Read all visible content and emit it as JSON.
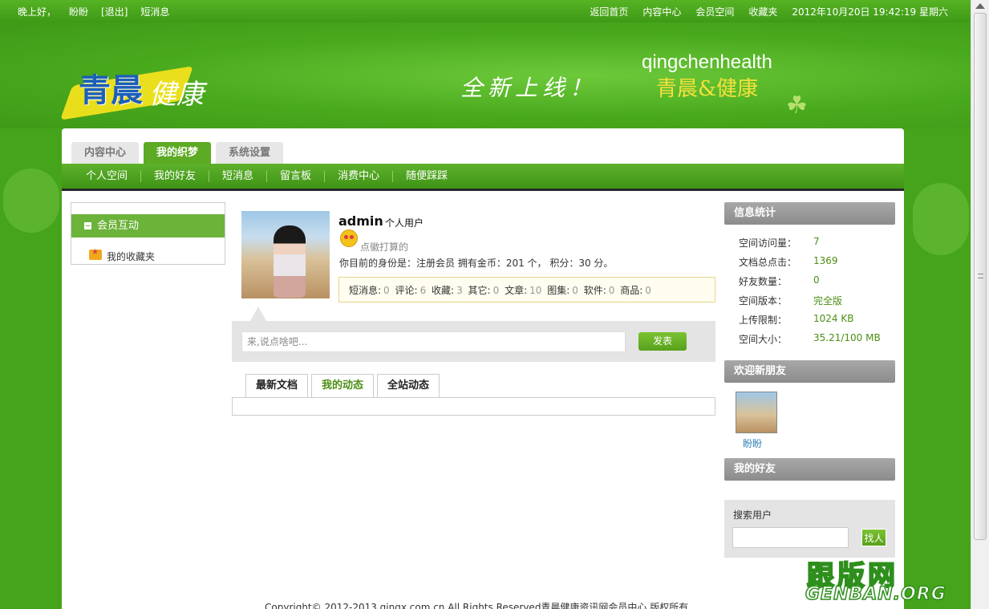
{
  "topbar": {
    "greeting": "晚上好，",
    "username": "盼盼",
    "logout": "[退出]",
    "messages": "短消息",
    "home": "返回首页",
    "content_center": "内容中心",
    "member_space": "会员空间",
    "favorites": "收藏夹",
    "datetime": "2012年10月20日 19:42:19 星期六"
  },
  "banner": {
    "logo_text_1": "青晨",
    "logo_text_2": "健康",
    "slogan": "全新上线！",
    "brand_en": "qingchenhealth",
    "brand_cn": "青晨&健康"
  },
  "tabs": [
    "内容中心",
    "我的织梦",
    "系统设置"
  ],
  "subnav": [
    "个人空间",
    "我的好友",
    "短消息",
    "留言板",
    "消费中心",
    "随便踩踩"
  ],
  "leftmenu": {
    "header": "会员互动",
    "item": "我的收藏夹"
  },
  "profile": {
    "name": "admin",
    "type": "个人用户",
    "mood": "点徽打算的",
    "info": "你目前的身份是：注册会员  拥有金币：201 个，  积分：30 分。",
    "stats": [
      {
        "label": "短消息:",
        "value": "0"
      },
      {
        "label": "评论:",
        "value": "6"
      },
      {
        "label": "收藏:",
        "value": "3"
      },
      {
        "label": "其它:",
        "value": "0"
      },
      {
        "label": "文章:",
        "value": "10"
      },
      {
        "label": "图集:",
        "value": "0"
      },
      {
        "label": "软件:",
        "value": "0"
      },
      {
        "label": "商品:",
        "value": "0"
      }
    ]
  },
  "saybox": {
    "placeholder": "来,说点啥吧...",
    "button": "发表"
  },
  "feed_tabs": [
    "最新文档",
    "我的动态",
    "全站动态"
  ],
  "right": {
    "stats_title": "信息统计",
    "stats": [
      {
        "k": "空间访问量：",
        "v": "7"
      },
      {
        "k": "文档总点击：",
        "v": "1369"
      },
      {
        "k": "好友数量：",
        "v": "0"
      },
      {
        "k": "空间版本：",
        "v": "完全版"
      },
      {
        "k": "上传限制：",
        "v": "1024 KB"
      },
      {
        "k": "空间大小：",
        "v": "35.21/100 MB"
      }
    ],
    "new_friends_title": "欢迎新朋友",
    "new_friend_name": "盼盼",
    "my_friends_title": "我的好友",
    "search_label": "搜索用户",
    "search_button": "找人"
  },
  "footer": {
    "copyright": "Copyright© 2012-2013 qingx.com.cn All Rights Reserved青晨健康资讯网会员中心 版权所有"
  },
  "watermark": {
    "cn": "跟版网",
    "en": "GENBAN.ORG"
  }
}
